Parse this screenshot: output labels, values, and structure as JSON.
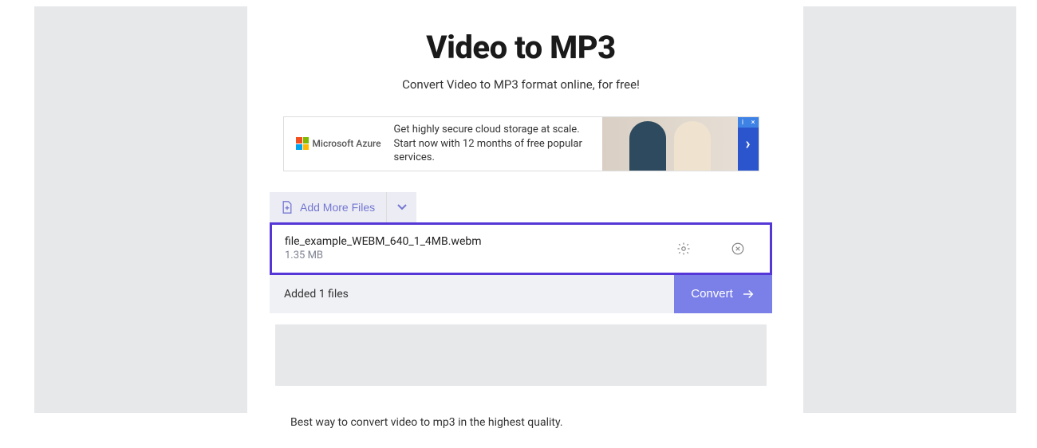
{
  "page": {
    "title": "Video to MP3",
    "subtitle": "Convert Video to MP3 format online, for free!"
  },
  "ad_banner": {
    "brand": "Microsoft Azure",
    "text": "Get highly secure cloud storage at scale. Start now with 12 months of free popular services.",
    "arrow": "›"
  },
  "toolbar": {
    "add_label": "Add More Files"
  },
  "file": {
    "name": "file_example_WEBM_640_1_4MB.webm",
    "size": "1.35 MB"
  },
  "footer": {
    "status": "Added 1 files",
    "convert_label": "Convert"
  },
  "info": {
    "text": "Best way to convert video to mp3 in the highest quality."
  }
}
